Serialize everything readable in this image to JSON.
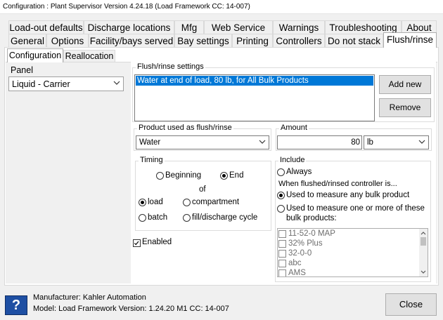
{
  "window": {
    "title": "Configuration : Plant Supervisor Version 4.24.18 (Load Framework CC: 14-007)"
  },
  "tabs_row1": [
    "Load-out defaults",
    "Discharge locations",
    "Mfg",
    "Web Service",
    "Warnings",
    "Troubleshooting",
    "About"
  ],
  "tabs_row2": [
    "General",
    "Options",
    "Facility/bays served",
    "Bay settings",
    "Printing",
    "Controllers",
    "Do not stack",
    "Flush/rinse"
  ],
  "subtabs": [
    "Configuration",
    "Reallocation"
  ],
  "panel": {
    "label": "Panel",
    "value": "Liquid - Carrier"
  },
  "flush": {
    "title": "Flush/rinse settings",
    "items": [
      "Water at end of load, 80 lb, for All Bulk Products"
    ],
    "add_label": "Add new",
    "remove_label": "Remove"
  },
  "product": {
    "title": "Product used as flush/rinse",
    "value": "Water"
  },
  "amount": {
    "title": "Amount",
    "value": "80",
    "unit": "lb"
  },
  "timing": {
    "title": "Timing",
    "beginning": "Beginning",
    "end": "End",
    "of": "of",
    "load": "load",
    "compartment": "compartment",
    "batch": "batch",
    "fill": "fill/discharge cycle"
  },
  "enabled_label": "Enabled",
  "include": {
    "title": "Include",
    "always": "Always",
    "when": "When flushed/rinsed controller is...",
    "any": "Used to measure any bulk product",
    "some_line1": "Used to measure one or more of these",
    "some_line2": "bulk products:",
    "products": [
      "11-52-0 MAP",
      "32% Plus",
      "32-0-0",
      "abc",
      "AMS"
    ]
  },
  "footer": {
    "manufacturer": "Manufacturer: Kahler Automation",
    "model": "Model: Load Framework Version: 1.24.20 M1 CC: 14-007",
    "close_label": "Close"
  },
  "colors": {
    "selection": "#0078d7",
    "help_blue": "#1e4fa3"
  }
}
